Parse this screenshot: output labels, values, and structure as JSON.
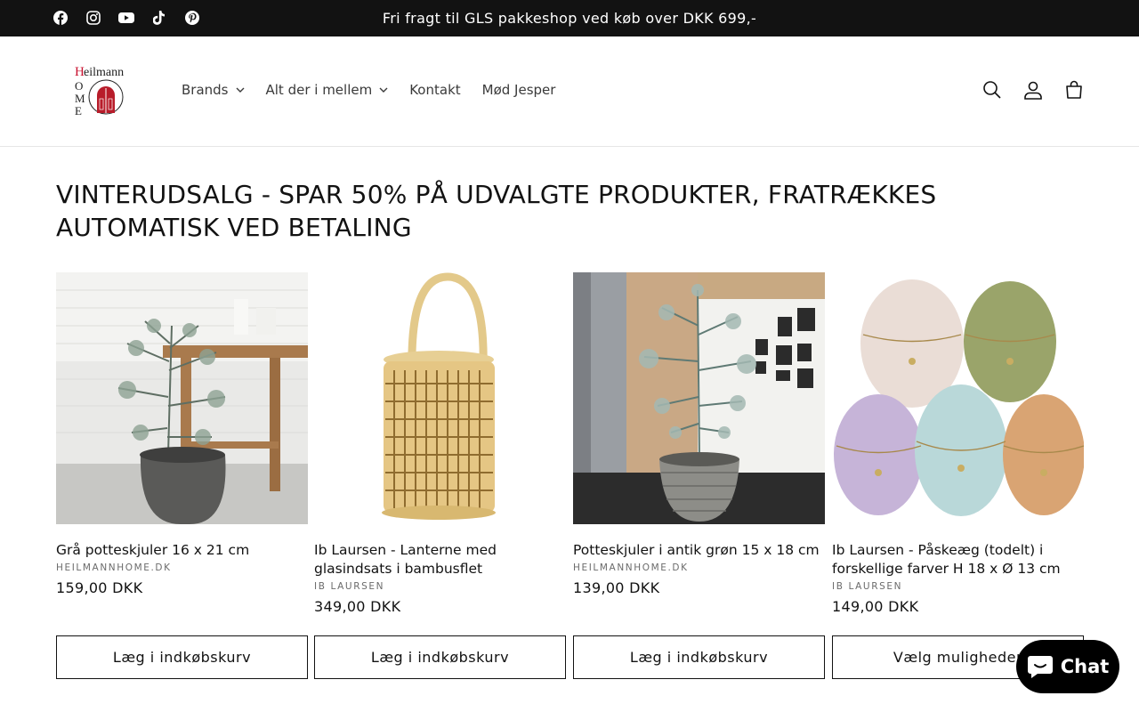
{
  "announcement": {
    "text": "Fri fragt til GLS pakkeshop ved køb over DKK 699,-",
    "social": [
      "facebook-icon",
      "instagram-icon",
      "youtube-icon",
      "tiktok-icon",
      "pinterest-icon"
    ]
  },
  "header": {
    "logo_text": "Heilmann HOME",
    "nav": [
      {
        "label": "Brands",
        "dropdown": true
      },
      {
        "label": "Alt der i mellem",
        "dropdown": true
      },
      {
        "label": "Kontakt",
        "dropdown": false
      },
      {
        "label": "Mød Jesper",
        "dropdown": false
      }
    ],
    "icons": [
      "search-icon",
      "account-icon",
      "cart-icon"
    ]
  },
  "main": {
    "title": "VINTERUDSALG - SPAR 50% PÅ UDVALGTE PRODUKTER, FRATRÆKKES AUTOMATISK VED BETALING",
    "products": [
      {
        "title": "Grå potteskjuler 16 x 21 cm",
        "vendor": "HEILMANNHOME.DK",
        "price": "159,00 DKK",
        "button": "Læg i indkøbskurv"
      },
      {
        "title": "Ib Laursen - Lanterne med glasindsats i bambusflet",
        "vendor": "IB LAURSEN",
        "price": "349,00 DKK",
        "button": "Læg i indkøbskurv"
      },
      {
        "title": "Potteskjuler i antik grøn 15 x 18 cm",
        "vendor": "HEILMANNHOME.DK",
        "price": "139,00 DKK",
        "button": "Læg i indkøbskurv"
      },
      {
        "title": "Ib Laursen - Påskeæg (todelt) i forskellige farver H 18 x Ø 13 cm",
        "vendor": "IB LAURSEN",
        "price": "149,00 DKK",
        "button": "Vælg muligheder"
      }
    ]
  },
  "chat": {
    "label": "Chat",
    "color": "#000000"
  },
  "colors": {
    "announcement_bg": "#121212",
    "text": "#121212",
    "accent_red": "#c8102e"
  }
}
